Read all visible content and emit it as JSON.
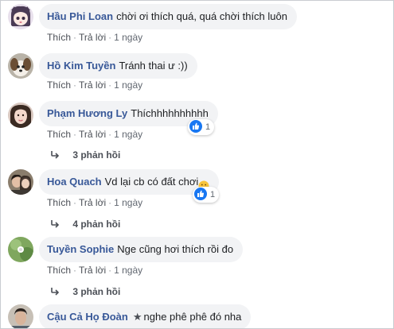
{
  "actions": {
    "like": "Thích",
    "reply": "Trả lời",
    "separator": "·"
  },
  "comments": [
    {
      "author": "Hầu Phi Loan",
      "text": "chời ơi thích quá, quá chời thích luôn",
      "time": "1 ngày",
      "avatar_icon": "cartoon-girl-avatar"
    },
    {
      "author": "Hồ Kim Tuyền",
      "text": "Tránh thai ư :))",
      "time": "1 ngày",
      "avatar_icon": "puppy-avatar"
    },
    {
      "author": "Phạm Hương Ly",
      "text": "Thíchhhhhhhhhh",
      "time": "1 ngày",
      "reactions": "1",
      "replies": "3 phản hồi",
      "avatar_icon": "girl-photo-avatar"
    },
    {
      "author": "Hoa Quach",
      "text": "Vd lại cb có đất chơi",
      "time": "1 ngày",
      "reactions": "1",
      "replies": "4 phản hồi",
      "avatar_icon": "couple-photo-avatar"
    },
    {
      "author": "Tuyền Sophie",
      "text": "Nge cũng hơi thích rồi đo",
      "time": "1 ngày",
      "replies": "3 phản hồi",
      "avatar_icon": "nature-photo-avatar"
    },
    {
      "author": "Cậu Cả Họ Đoàn",
      "text": "nghe phê phê đó nha",
      "avatar_icon": "man-photo-avatar"
    }
  ],
  "colors": {
    "author": "#385898",
    "bubble": "#f2f3f5",
    "like_blue": "#1877f2",
    "meta": "#616770"
  }
}
